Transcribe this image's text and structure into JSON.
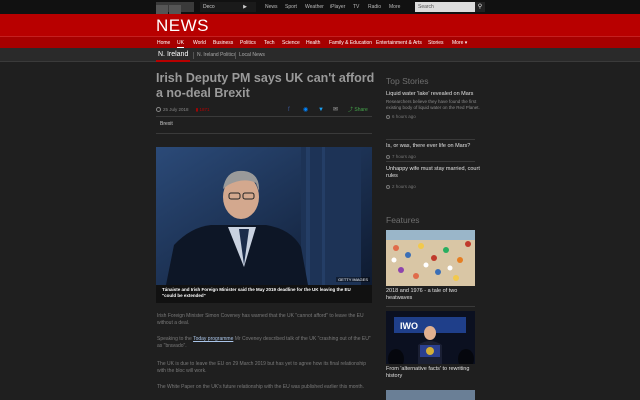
{
  "topbar": {
    "deco_label": "Deco",
    "nav": [
      "News",
      "Sport",
      "Weather",
      "iPlayer",
      "TV",
      "Radio",
      "More"
    ],
    "search_placeholder": "Search"
  },
  "masthead": {
    "title": "NEWS"
  },
  "nav": {
    "items": [
      "Home",
      "UK",
      "World",
      "Business",
      "Politics",
      "Tech",
      "Science",
      "Health",
      "Family & Education",
      "Entertainment & Arts",
      "Stories",
      "More"
    ],
    "active": "UK"
  },
  "subnav": {
    "section": "N. Ireland",
    "items": [
      "N. Ireland Politics",
      "Local News"
    ]
  },
  "article": {
    "headline": "Irish Deputy PM says UK can't afford a no-deal Brexit",
    "date": "25 July 2018",
    "comments": "1871",
    "share_label": "Share",
    "tag": "Brexit",
    "image_credit": "GETTY IMAGES",
    "caption": "Tánaiste and Irish Foreign Minister said the May 2019 deadline for the UK leaving the EU \"could be extended\"",
    "paragraphs": [
      {
        "text": "Irish Foreign Minister Simon Coveney has warned that the UK \"cannot afford\" to leave the EU without a deal."
      },
      {
        "pre": "Speaking to the ",
        "link": "Today programme",
        "post": " Mr Coveney described talk of the UK \"crashing out of the EU\" as \"bravado\"."
      },
      {
        "text": "The UK is due to leave the EU on 29 March 2019 but has yet to agree how its final relationship with the bloc will work."
      },
      {
        "text": "The White Paper on the UK's future relationship with the EU was published earlier this month."
      }
    ]
  },
  "sidebar": {
    "top_stories_heading": "Top Stories",
    "top_stories": [
      {
        "title": "Liquid water 'lake' revealed on Mars",
        "summary": "Researchers believe they have found the first existing body of liquid water on the Red Planet.",
        "time": "6 hours ago"
      },
      {
        "title": "Is, or was, there ever life on Mars?",
        "time": "7 hours ago"
      },
      {
        "title": "Unhappy wife must stay married, court rules",
        "time": "2 hours ago"
      }
    ],
    "features_heading": "Features",
    "features": [
      {
        "title": "2018 and 1976 - a tale of two heatwaves"
      },
      {
        "title": "From 'alternative facts' to rewriting history"
      }
    ]
  },
  "colors": {
    "brand_red": "#b80000",
    "nav_red": "#a60000",
    "background": "#1f1f1f"
  }
}
